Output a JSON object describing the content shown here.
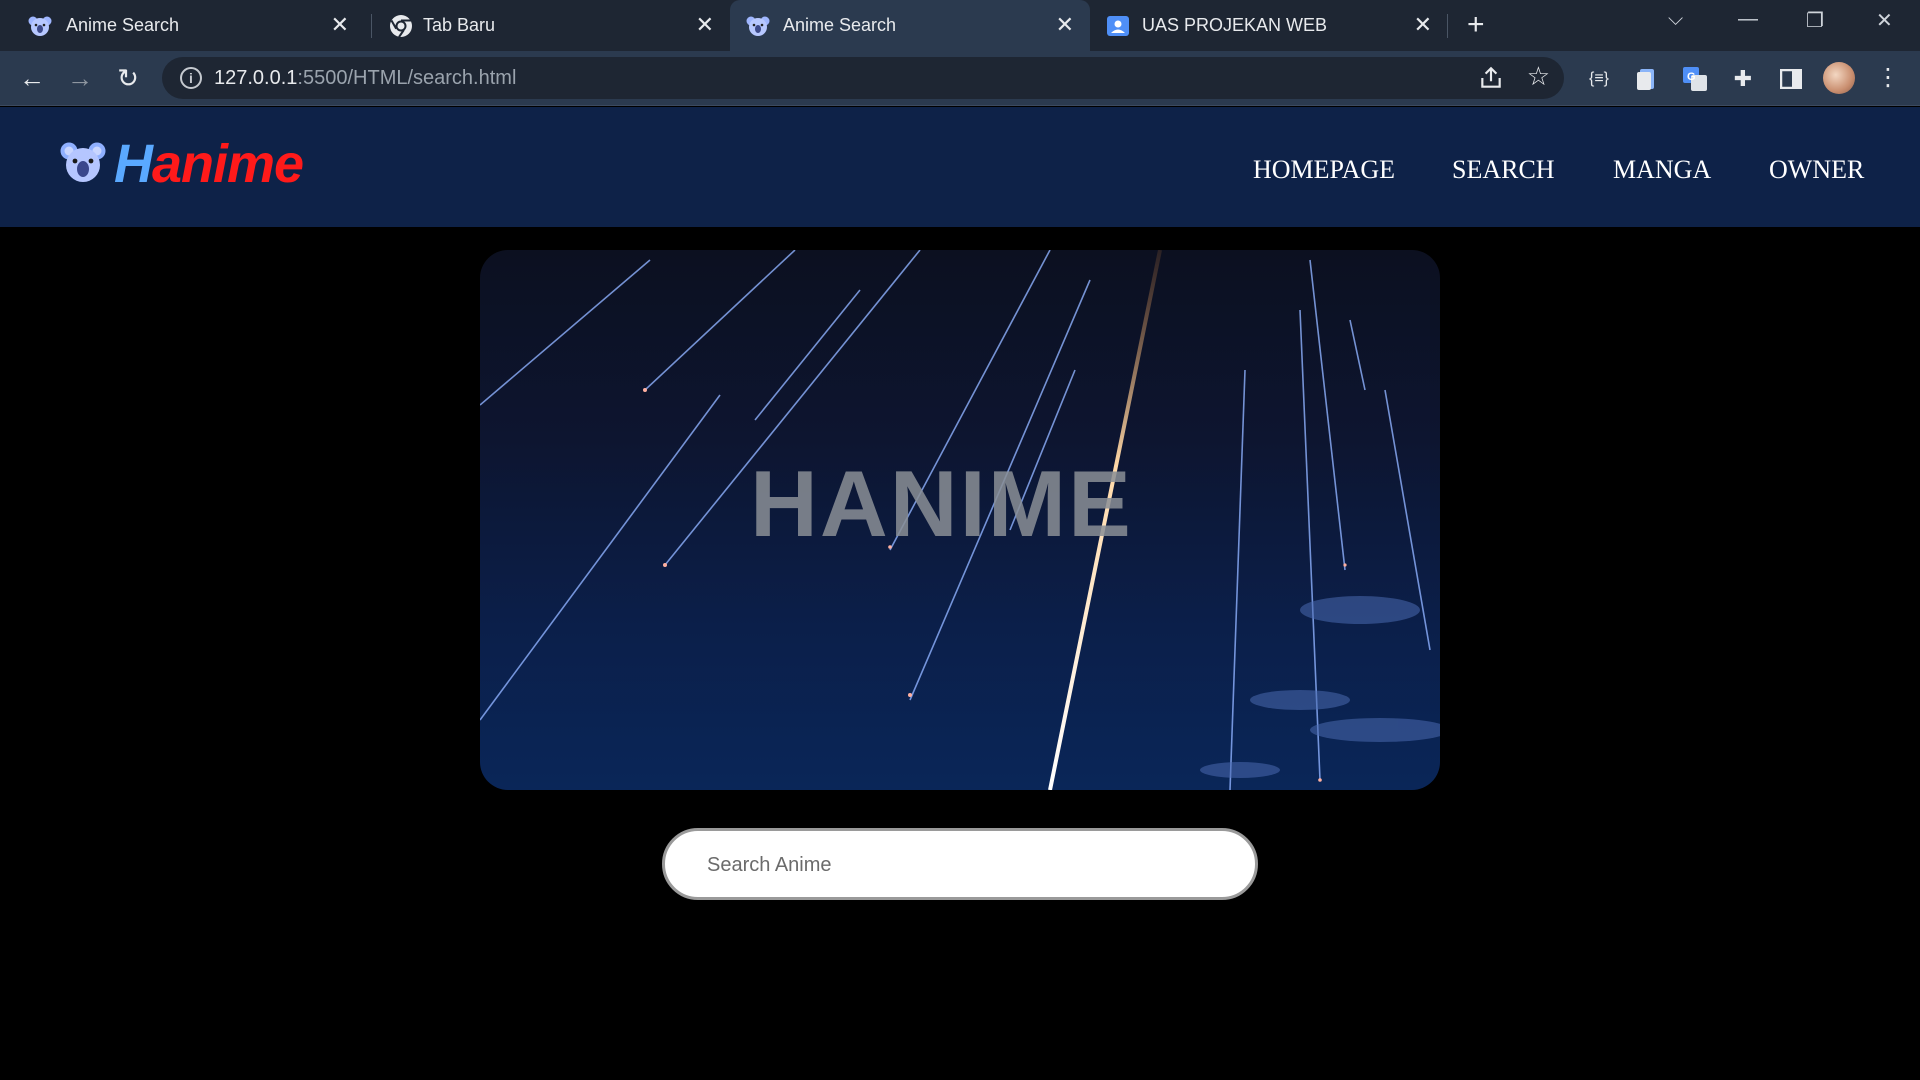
{
  "browser": {
    "tabs": [
      {
        "title": "Anime Search",
        "favicon": "koala-icon",
        "active": false
      },
      {
        "title": "Tab Baru",
        "favicon": "chrome-icon",
        "active": false
      },
      {
        "title": "Anime Search",
        "favicon": "koala-icon",
        "active": true
      },
      {
        "title": "UAS PROJEKAN WEB",
        "favicon": "contacts-icon",
        "active": false
      }
    ],
    "address": {
      "host": "127.0.0.1",
      "path": ":5500/HTML/search.html"
    }
  },
  "site": {
    "logo": {
      "first_letter": "H",
      "rest": "anime"
    },
    "nav": [
      "HOMEPAGE",
      "SEARCH",
      "MANGA",
      "OWNER"
    ]
  },
  "hero": {
    "title": "HANIME"
  },
  "search": {
    "placeholder": "Search Anime",
    "value": ""
  },
  "colors": {
    "header_bg": "#0e2248",
    "logo_h": "#5aa9ff",
    "logo_rest": "#ff1a1a",
    "page_bg": "#000000",
    "tabstrip_bg": "#1e2633",
    "toolbar_bg": "#2b3a4f"
  }
}
